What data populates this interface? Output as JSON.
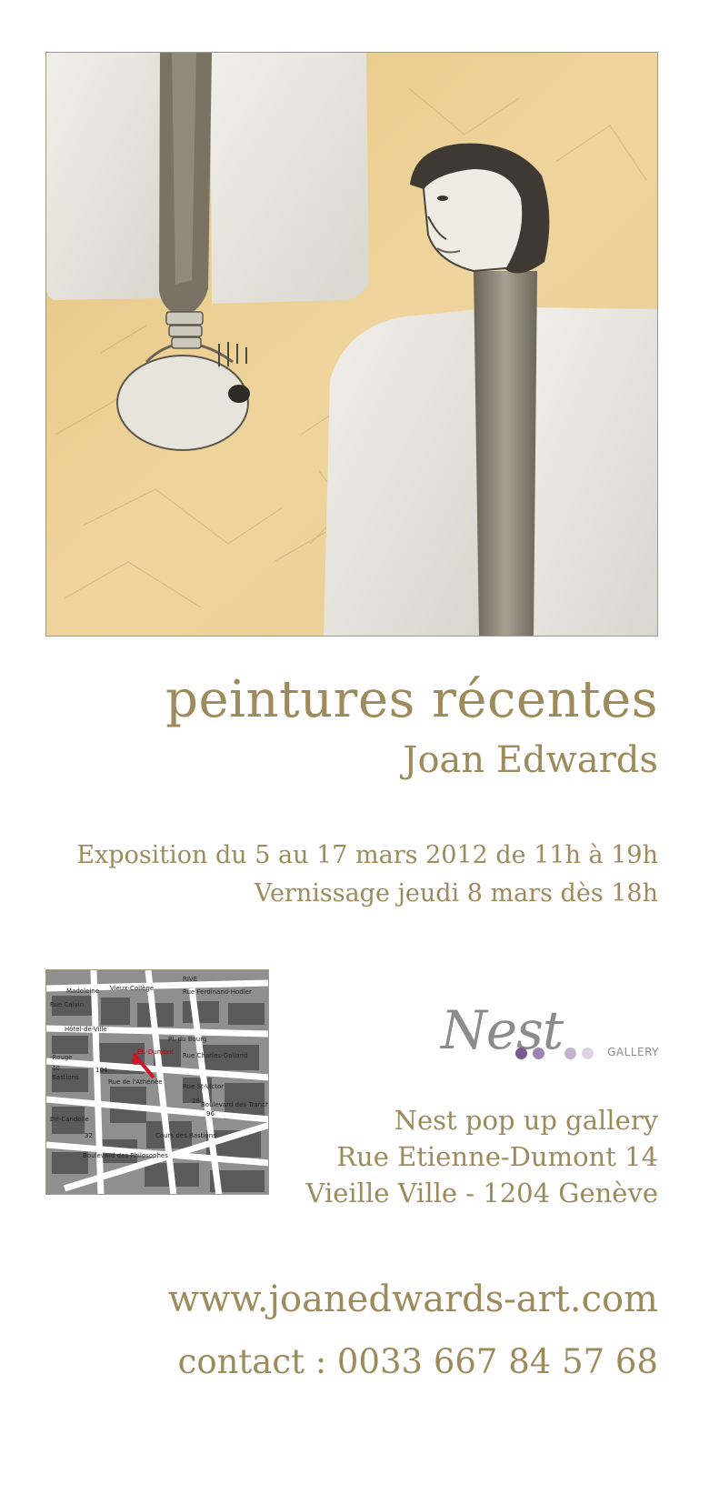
{
  "title": "peintures récentes",
  "artist": "Joan Edwards",
  "exhibition_line": "Exposition du 5 au 17 mars 2012 de 11h à 19h",
  "vernissage_line": "Vernissage jeudi 8 mars dès 18h",
  "logo": {
    "word": "Nest",
    "label": "GALLERY",
    "dot_colors": [
      "#7b5a93",
      "#9b86b1",
      "#c2b4d0",
      "#dcd3e5"
    ]
  },
  "address": {
    "line1": "Nest pop up gallery",
    "line2": "Rue Etienne-Dumont 14",
    "line3": "Vieille Ville - 1204 Genève"
  },
  "website": "www.joanedwards-art.com",
  "contact": "contact : 0033 667 84 57 68",
  "map_labels": {
    "medeleine": "Madeleine",
    "vieux_college": "Vieux-Collège",
    "rive": "RIVE",
    "ferdinand": "Rue Ferdinand-Hodler",
    "calvin": "Rue Calvin",
    "hotel": "Hôtel-de-Ville",
    "charles": "Rue Charles-Galland",
    "rouge": "-Rouge",
    "athenee": "Rue de l'Athénée",
    "victor": "Rue St-Victor",
    "bastions": "Bastions",
    "candolle": "De-Candolle",
    "philosophes": "Boulevard des Philosophes",
    "tranchees": "Boulevard des Tranchées",
    "cours": "Cours des Bastions",
    "dumont": "Et.-Dumont",
    "bourg": "Pl. du Bourg",
    "num_40": "40",
    "num_104": "104",
    "num_32": "32",
    "num_28": "28",
    "num_96": "96"
  },
  "colors": {
    "text": "#9d8b5c",
    "border": "#a39a7c",
    "background": "#ffffff"
  }
}
